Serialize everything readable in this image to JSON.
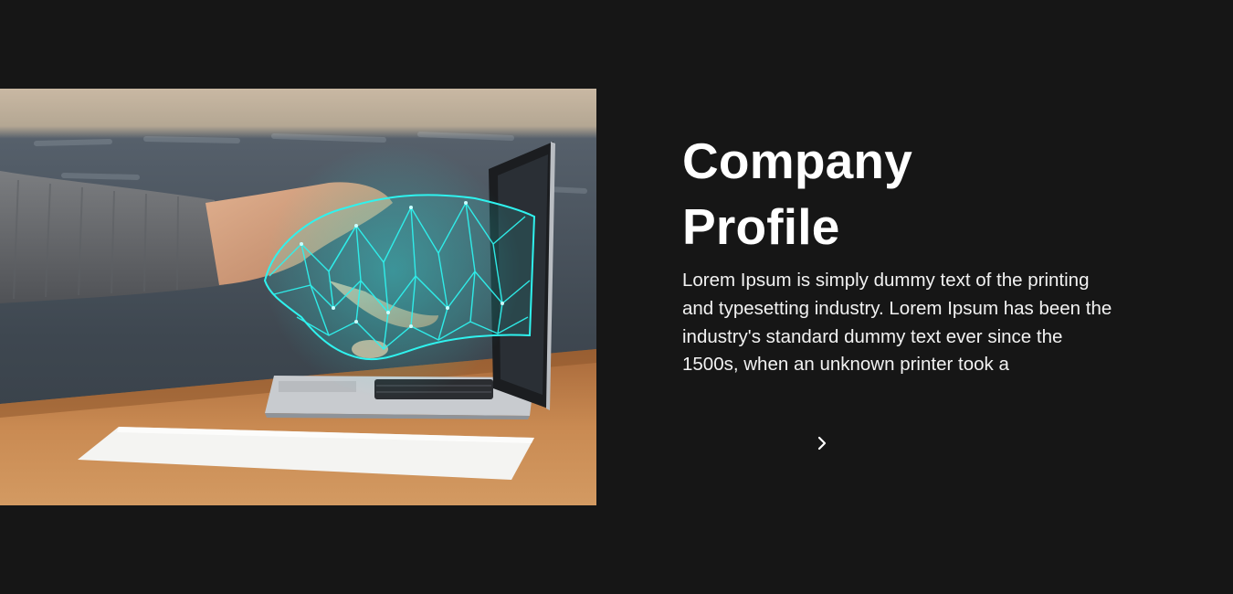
{
  "profile": {
    "title_line1": "Company",
    "title_line2": "Profile",
    "description": "Lorem Ipsum is simply dummy text of the printing and typesetting industry. Lorem Ipsum has been the industry's standard dummy text ever since the 1500s, when an unknown printer took a",
    "next_icon": "chevron-right-icon"
  },
  "image": {
    "subject": "handshake-laptop-photo"
  },
  "colors": {
    "background": "#161616",
    "text": "#ffffff",
    "accent_wireframe": "#2ff2ee"
  }
}
